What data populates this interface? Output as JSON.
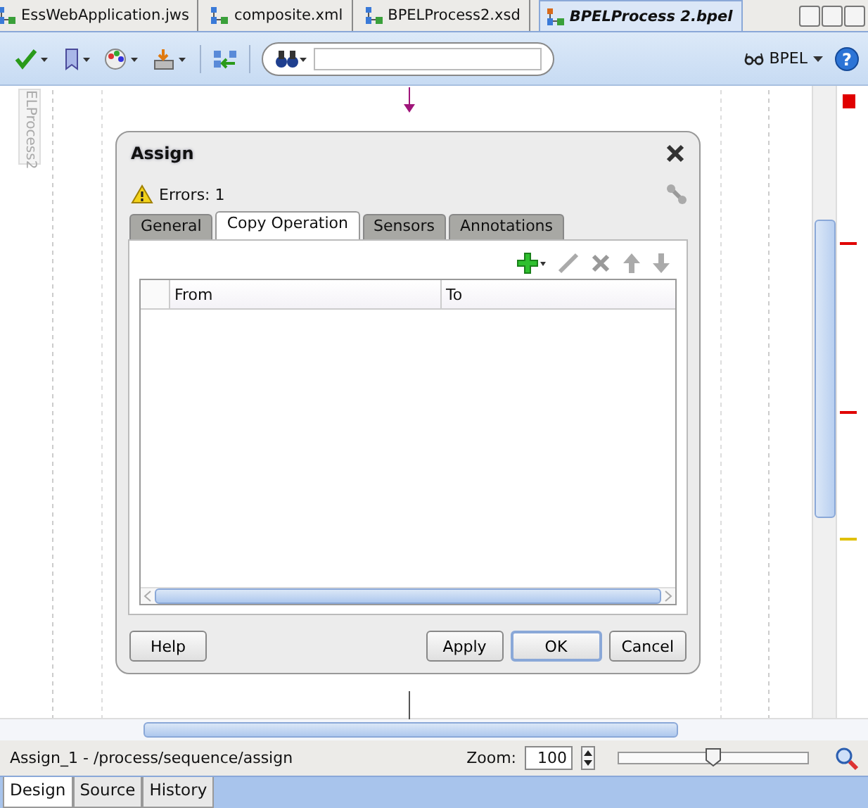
{
  "editor_tabs": [
    {
      "label": "EssWebApplication.jws",
      "selected": false
    },
    {
      "label": "composite.xml",
      "selected": false
    },
    {
      "label": "BPELProcess2.xsd",
      "selected": false
    },
    {
      "label": "BPELProcess 2.bpel",
      "selected": true
    }
  ],
  "toolbar": {
    "mode_menu": "BPEL",
    "help": "?"
  },
  "canvas": {
    "side_label": "ELProcess2",
    "overview_marks": [
      {
        "color": "#e00000"
      },
      {
        "color": "#e00000"
      },
      {
        "color": "#e00000"
      },
      {
        "color": "#e0c000"
      }
    ]
  },
  "dialog": {
    "title": "Assign",
    "errors": "Errors: 1",
    "tabs": [
      {
        "label": "General",
        "selected": false
      },
      {
        "label": "Copy Operation",
        "selected": true
      },
      {
        "label": "Sensors",
        "selected": false
      },
      {
        "label": "Annotations",
        "selected": false
      }
    ],
    "table": {
      "columns": [
        "From",
        "To"
      ]
    },
    "buttons": [
      {
        "label": "Help",
        "default": false
      },
      {
        "label": "Apply",
        "default": false
      },
      {
        "label": "OK",
        "default": true
      },
      {
        "label": "Cancel",
        "default": false
      }
    ]
  },
  "status": {
    "path": "Assign_1 - /process/sequence/assign",
    "zoom_label": "Zoom:",
    "zoom_value": "100",
    "zoom_slider": {
      "level": 0.5
    }
  },
  "view_tabs": [
    {
      "label": "Design",
      "selected": true
    },
    {
      "label": "Source",
      "selected": false
    },
    {
      "label": "History",
      "selected": false
    }
  ]
}
